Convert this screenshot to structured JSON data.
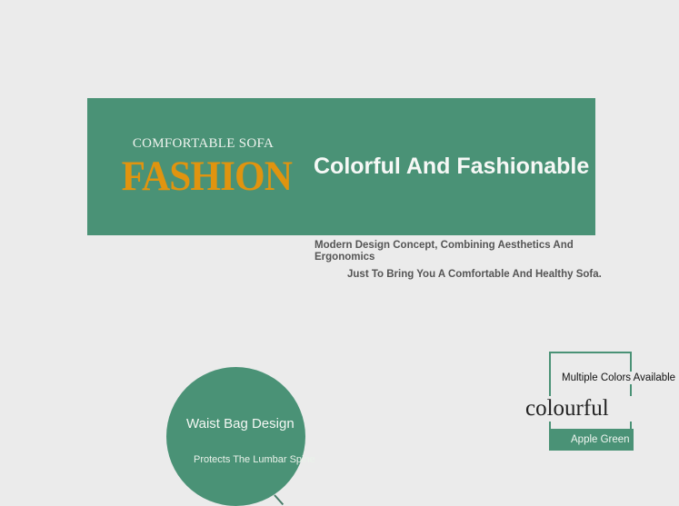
{
  "banner": {
    "subtitle": "COMFORTABLE SOFA",
    "headline": "FASHION",
    "title": "Colorful And Fashionable"
  },
  "description": {
    "line1": "Modern Design Concept, Combining Aesthetics And Ergonomics",
    "line2": "Just To Bring You A Comfortable And Healthy Sofa."
  },
  "feature": {
    "title": "Waist Bag Design",
    "subtitle": "Protects The Lumbar Spine"
  },
  "colors": {
    "label": "Multiple Colors Available",
    "heading": "colourful",
    "selected": "Apple Green"
  },
  "theme": {
    "green": "#4a9276",
    "orange": "#e0940f",
    "background": "#ebebeb"
  }
}
